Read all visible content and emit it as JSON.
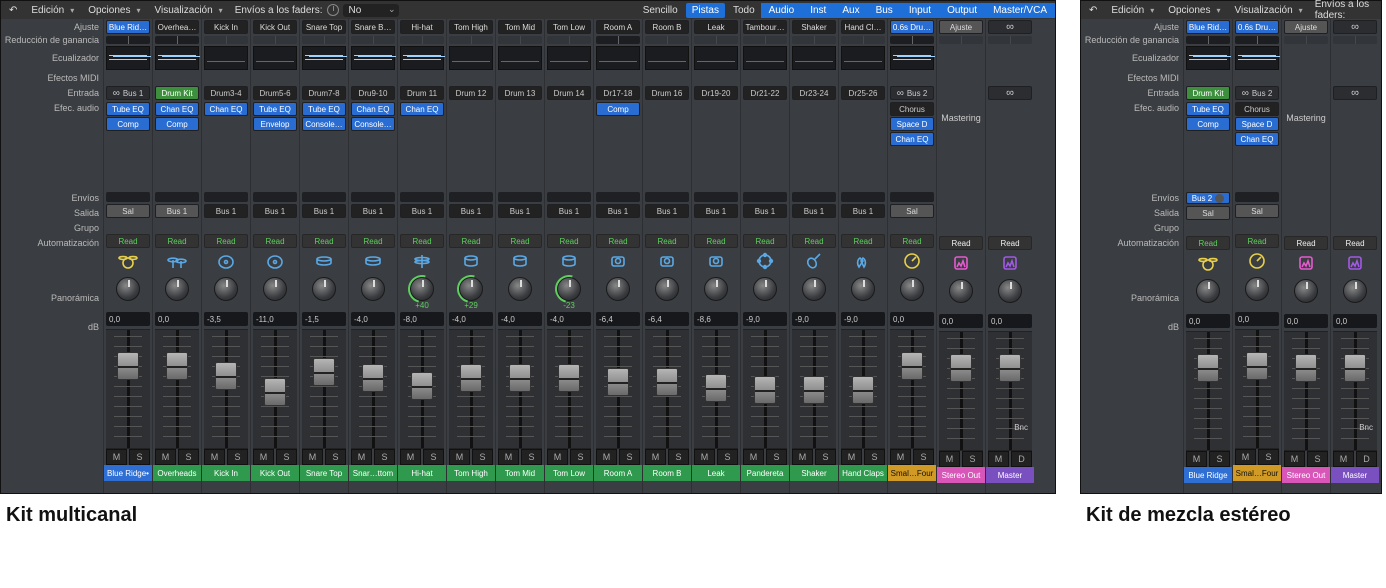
{
  "captions": {
    "a": "Kit multicanal",
    "b": "Kit de mezcla estéreo"
  },
  "menu": {
    "edit": "Edición",
    "options": "Opciones",
    "view": "Visualización",
    "sends_to_faders": "Envíos a los faders:",
    "sends_value": "No",
    "view_modes": {
      "simple": "Sencillo",
      "tracks": "Pistas",
      "all": "Todo"
    },
    "tabs": [
      "Audio",
      "Inst",
      "Aux",
      "Bus",
      "Input",
      "Output",
      "Master/VCA"
    ]
  },
  "row_labels": {
    "ajuste": "Ajuste",
    "gain_red": "Reducción de ganancia",
    "eq": "Ecualizador",
    "midi_fx": "Efectos MIDI",
    "input": "Entrada",
    "audio_fx": "Efec. audio",
    "sends": "Envíos",
    "output": "Salida",
    "group": "Grupo",
    "auto": "Automatización",
    "pan": "Panorámica",
    "db": "dB"
  },
  "mastering_label": "Mastering",
  "bnc": "Bnc",
  "ms": {
    "m": "M",
    "s": "S",
    "d": "D"
  },
  "channel_names_a": [
    "Blue Ridge•",
    "Overheads",
    "Kick In",
    "Kick Out",
    "Snare Top",
    "Snar…ttom",
    "Hi-hat",
    "Tom High",
    "Tom Mid",
    "Tom Low",
    "Room A",
    "Room B",
    "Leak",
    "Pandereta",
    "Shaker",
    "Hand Claps",
    "Smal…Four",
    "Stereo Out",
    "Master"
  ],
  "channel_names_b": [
    "Blue Ridge",
    "Smal…Four",
    "Stereo Out",
    "Master"
  ],
  "header_a": [
    {
      "name": "Blue Rid…",
      "input": "Bus 1",
      "input_style": "link",
      "fx": [
        "Tube EQ",
        "Comp"
      ],
      "fxstyle": "blue",
      "eq": "curve",
      "out": "Sal",
      "out_style": "gray",
      "auto": "Read",
      "autoc": "green",
      "icon": "kit-y",
      "db": "0,0",
      "cap": 22,
      "gain": true,
      "namec": "blue",
      "pan": ""
    },
    {
      "name": "Overhea…",
      "input": "Drum Kit",
      "input_style": "green",
      "fx": [
        "Chan EQ",
        "Comp"
      ],
      "fxstyle": "blue",
      "eq": "curve",
      "out": "Bus 1",
      "out_style": "gray",
      "auto": "Read",
      "autoc": "green",
      "icon": "cymbals",
      "db": "0,0",
      "cap": 22,
      "gain": true,
      "namec": "green",
      "pan": ""
    },
    {
      "name": "Kick In",
      "input": "Drum3-4",
      "fx": [
        "Chan EQ"
      ],
      "fxstyle": "blue",
      "eq": "line",
      "out": "Bus 1",
      "auto": "Read",
      "autoc": "green",
      "icon": "kick",
      "db": "-3,5",
      "cap": 32,
      "namec": "green",
      "pan": ""
    },
    {
      "name": "Kick Out",
      "input": "Drum5-6",
      "fx": [
        "Tube EQ",
        "Envelop"
      ],
      "fxstyle": "blue",
      "eq": "line",
      "out": "Bus 1",
      "auto": "Read",
      "autoc": "green",
      "icon": "kick",
      "db": "-11,0",
      "cap": 48,
      "namec": "green",
      "pan": ""
    },
    {
      "name": "Snare Top",
      "input": "Drum7-8",
      "fx": [
        "Tube EQ",
        "Console…"
      ],
      "fxstyle": "blue",
      "eq": "curve",
      "out": "Bus 1",
      "auto": "Read",
      "autoc": "green",
      "icon": "snare",
      "db": "-1,5",
      "cap": 28,
      "namec": "green",
      "pan": ""
    },
    {
      "name": "Snare B…",
      "input": "Dru9-10",
      "fx": [
        "Chan EQ",
        "Console…"
      ],
      "fxstyle": "blue",
      "eq": "curve",
      "out": "Bus 1",
      "auto": "Read",
      "autoc": "green",
      "icon": "snare",
      "db": "-4,0",
      "cap": 34,
      "namec": "green",
      "pan": ""
    },
    {
      "name": "Hi-hat",
      "input": "Drum 11",
      "fx": [
        "Chan EQ"
      ],
      "fxstyle": "blue",
      "eq": "curve",
      "out": "Bus 1",
      "auto": "Read",
      "autoc": "green",
      "icon": "hat",
      "db": "-8,0",
      "cap": 42,
      "namec": "green",
      "pan": "+40",
      "ring": true
    },
    {
      "name": "Tom High",
      "input": "Drum 12",
      "fx": [],
      "eq": "line",
      "out": "Bus 1",
      "auto": "Read",
      "autoc": "green",
      "icon": "tom",
      "db": "-4,0",
      "cap": 34,
      "namec": "green",
      "pan": "+29",
      "ring": true
    },
    {
      "name": "Tom Mid",
      "input": "Drum 13",
      "fx": [],
      "eq": "line",
      "out": "Bus 1",
      "auto": "Read",
      "autoc": "green",
      "icon": "tom",
      "db": "-4,0",
      "cap": 34,
      "namec": "green",
      "pan": ""
    },
    {
      "name": "Tom Low",
      "input": "Drum 14",
      "fx": [],
      "eq": "line",
      "out": "Bus 1",
      "auto": "Read",
      "autoc": "green",
      "icon": "tom",
      "db": "-4,0",
      "cap": 34,
      "namec": "green",
      "pan": "-23",
      "ring": true
    },
    {
      "name": "Room A",
      "input": "Dr17-18",
      "fx": [
        "Comp"
      ],
      "fxstyle": "blue",
      "eq": "line",
      "out": "Bus 1",
      "auto": "Read",
      "autoc": "green",
      "icon": "room",
      "db": "-6,4",
      "cap": 38,
      "gain": true,
      "namec": "green",
      "pan": ""
    },
    {
      "name": "Room B",
      "input": "Drum 16",
      "fx": [],
      "eq": "line",
      "out": "Bus 1",
      "auto": "Read",
      "autoc": "green",
      "icon": "room",
      "db": "-6,4",
      "cap": 38,
      "namec": "green",
      "pan": ""
    },
    {
      "name": "Leak",
      "input": "Dr19-20",
      "fx": [],
      "eq": "line",
      "out": "Bus 1",
      "auto": "Read",
      "autoc": "green",
      "icon": "room",
      "db": "-8,6",
      "cap": 44,
      "namec": "green",
      "pan": ""
    },
    {
      "name": "Tambour…",
      "input": "Dr21-22",
      "fx": [],
      "eq": "line",
      "out": "Bus 1",
      "auto": "Read",
      "autoc": "green",
      "icon": "tamb",
      "db": "-9,0",
      "cap": 46,
      "namec": "green",
      "pan": ""
    },
    {
      "name": "Shaker",
      "input": "Dr23-24",
      "fx": [],
      "eq": "line",
      "out": "Bus 1",
      "auto": "Read",
      "autoc": "green",
      "icon": "shaker",
      "db": "-9,0",
      "cap": 46,
      "namec": "green",
      "pan": ""
    },
    {
      "name": "Hand Cl…",
      "input": "Dr25-26",
      "fx": [],
      "eq": "line",
      "out": "Bus 1",
      "auto": "Read",
      "autoc": "green",
      "icon": "clap",
      "db": "-9,0",
      "cap": 46,
      "namec": "green",
      "pan": ""
    },
    {
      "name": "0.6s Dru…",
      "input": "Bus 2",
      "input_style": "link",
      "fx": [
        "Chorus",
        "Space D",
        "Chan EQ"
      ],
      "fxstyle": "blue",
      "fx0gray": true,
      "eq": "curve",
      "out": "Sal",
      "out_style": "gray",
      "auto": "Read",
      "autoc": "green",
      "icon": "meter-y",
      "db": "0,0",
      "cap": 22,
      "gain": true,
      "namec": "orange",
      "pan": ""
    },
    {
      "name": "Ajuste",
      "input": "",
      "fx": [],
      "eq": "none",
      "hide_eq": true,
      "out": "",
      "auto": "Read",
      "autoc": "white",
      "icon": "meter-p",
      "db": "0,0",
      "cap": 22,
      "namec": "pink",
      "pan": "",
      "is_output": true,
      "header_style": "gray",
      "sendsrow_text": "Mastering"
    },
    {
      "name": "",
      "input": "",
      "fx": [],
      "eq": "none",
      "hide_eq": true,
      "out": "",
      "auto": "Read",
      "autoc": "white",
      "icon": "meter-v",
      "db": "0,0",
      "cap": 22,
      "namec": "purple",
      "pan": "",
      "is_master": true,
      "show_d": true,
      "bnc": true
    }
  ],
  "header_b": [
    {
      "name": "Blue Rid…",
      "input": "Drum Kit",
      "input_style": "green",
      "fx": [
        "Tube EQ",
        "Comp"
      ],
      "fxstyle": "blue",
      "eq": "curve",
      "out": "Sal",
      "out_style": "gray",
      "sends": "Bus 2",
      "sends_style": "blue",
      "auto": "Read",
      "autoc": "green",
      "icon": "kit-y",
      "db": "0,0",
      "cap": 22,
      "gain": true,
      "namec": "blue",
      "pan": ""
    },
    {
      "name": "0.6s Dru…",
      "input": "Bus 2",
      "input_style": "link",
      "fx": [
        "Chorus",
        "Space D",
        "Chan EQ"
      ],
      "fxstyle": "blue",
      "fx0gray": true,
      "eq": "curve",
      "out": "Sal",
      "out_style": "gray",
      "auto": "Read",
      "autoc": "green",
      "icon": "meter-y",
      "db": "0,0",
      "cap": 22,
      "gain": true,
      "namec": "orange",
      "pan": ""
    },
    {
      "name": "Ajuste",
      "input": "",
      "fx": [],
      "eq": "none",
      "hide_eq": true,
      "out": "",
      "auto": "Read",
      "autoc": "white",
      "icon": "meter-p",
      "db": "0,0",
      "cap": 22,
      "namec": "pink",
      "pan": "",
      "is_output": true,
      "header_style": "gray",
      "sendsrow_text": "Mastering"
    },
    {
      "name": "",
      "input": "",
      "fx": [],
      "eq": "none",
      "hide_eq": true,
      "out": "",
      "auto": "Read",
      "autoc": "white",
      "icon": "meter-v",
      "db": "0,0",
      "cap": 22,
      "namec": "purple",
      "pan": "",
      "is_master": true,
      "show_d": true,
      "bnc": true
    }
  ]
}
